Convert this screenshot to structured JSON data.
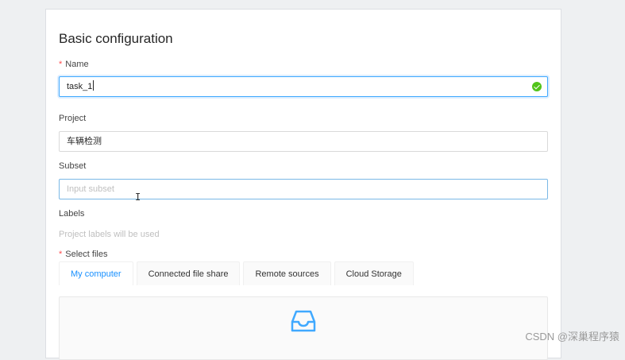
{
  "form": {
    "title": "Basic configuration",
    "required_mark": "*",
    "name_label": "Name",
    "name_value": "task_1",
    "project_label": "Project",
    "project_value": "车辆检测",
    "subset_label": "Subset",
    "subset_placeholder": "Input subset",
    "labels_label": "Labels",
    "labels_hint": "Project labels will be used",
    "files_label": "Select files"
  },
  "tabs": [
    {
      "label": "My computer",
      "active": true
    },
    {
      "label": "Connected file share",
      "active": false
    },
    {
      "label": "Remote sources",
      "active": false
    },
    {
      "label": "Cloud Storage",
      "active": false
    }
  ],
  "icons": {
    "valid": "check-circle-icon",
    "upload": "inbox-icon",
    "cursor": "text-cursor-icon"
  },
  "colors": {
    "accent": "#1890ff",
    "success": "#52c41a",
    "required": "#ff4d4f"
  },
  "watermark": "CSDN @深巢程序猿"
}
